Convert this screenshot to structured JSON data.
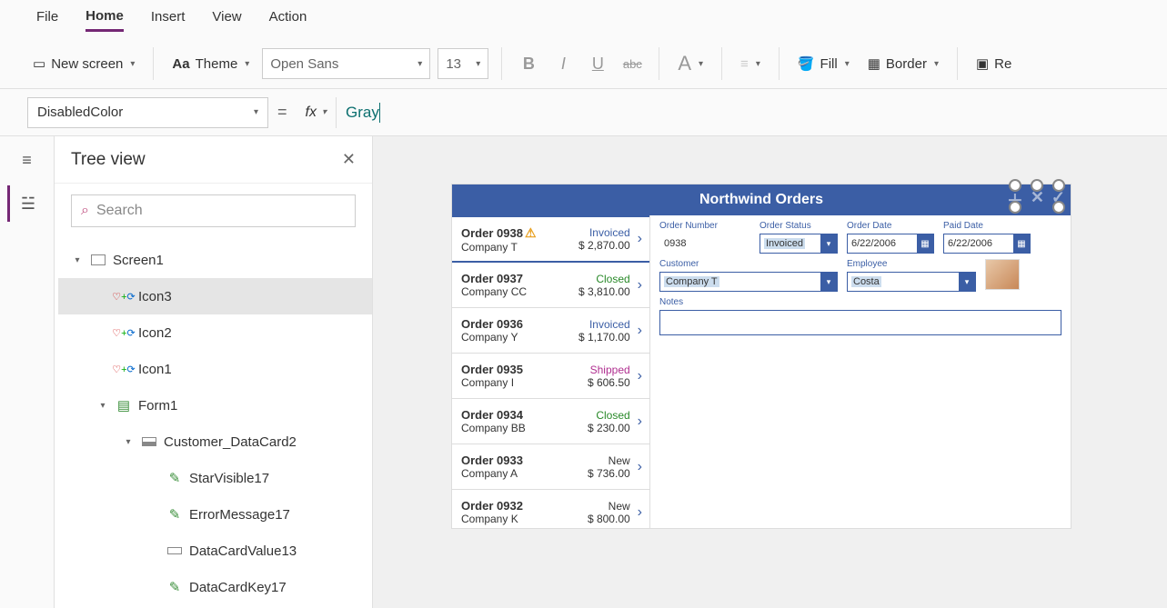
{
  "menu": {
    "file": "File",
    "home": "Home",
    "insert": "Insert",
    "view": "View",
    "action": "Action"
  },
  "ribbon": {
    "newscreen": "New screen",
    "theme": "Theme",
    "fontname": "Open Sans",
    "fontsize": "13",
    "fill": "Fill",
    "border": "Border",
    "reorder": "Re"
  },
  "formula": {
    "property": "DisabledColor",
    "value": "Gray"
  },
  "tree": {
    "title": "Tree view",
    "search_placeholder": "Search",
    "items": [
      {
        "depth": 0,
        "toggle": "▾",
        "icon": "screen",
        "label": "Screen1"
      },
      {
        "depth": 1,
        "toggle": "",
        "icon": "iconctl",
        "label": "Icon3",
        "selected": true
      },
      {
        "depth": 1,
        "toggle": "",
        "icon": "iconctl",
        "label": "Icon2"
      },
      {
        "depth": 1,
        "toggle": "",
        "icon": "iconctl",
        "label": "Icon1"
      },
      {
        "depth": 1,
        "toggle": "▾",
        "icon": "form",
        "label": "Form1"
      },
      {
        "depth": 2,
        "toggle": "▾",
        "icon": "card",
        "label": "Customer_DataCard2"
      },
      {
        "depth": 3,
        "toggle": "",
        "icon": "pencil",
        "label": "StarVisible17"
      },
      {
        "depth": 3,
        "toggle": "",
        "icon": "pencil",
        "label": "ErrorMessage17"
      },
      {
        "depth": 3,
        "toggle": "",
        "icon": "input",
        "label": "DataCardValue13"
      },
      {
        "depth": 3,
        "toggle": "",
        "icon": "pencil",
        "label": "DataCardKey17"
      }
    ]
  },
  "app": {
    "title": "Northwind Orders",
    "orders": [
      {
        "name": "Order 0938",
        "company": "Company T",
        "status": "Invoiced",
        "amount": "$ 2,870.00",
        "warn": true,
        "sel": true
      },
      {
        "name": "Order 0937",
        "company": "Company CC",
        "status": "Closed",
        "amount": "$ 3,810.00"
      },
      {
        "name": "Order 0936",
        "company": "Company Y",
        "status": "Invoiced",
        "amount": "$ 1,170.00"
      },
      {
        "name": "Order 0935",
        "company": "Company I",
        "status": "Shipped",
        "amount": "$ 606.50"
      },
      {
        "name": "Order 0934",
        "company": "Company BB",
        "status": "Closed",
        "amount": "$ 230.00"
      },
      {
        "name": "Order 0933",
        "company": "Company A",
        "status": "New",
        "amount": "$ 736.00"
      },
      {
        "name": "Order 0932",
        "company": "Company K",
        "status": "New",
        "amount": "$ 800.00"
      }
    ],
    "detail": {
      "ordernum_label": "Order Number",
      "ordernum": "0938",
      "orderstatus_label": "Order Status",
      "orderstatus": "Invoiced",
      "orderdate_label": "Order Date",
      "orderdate": "6/22/2006",
      "paiddate_label": "Paid Date",
      "paiddate": "6/22/2006",
      "customer_label": "Customer",
      "customer": "Company T",
      "employee_label": "Employee",
      "employee": "Costa",
      "notes_label": "Notes"
    }
  }
}
